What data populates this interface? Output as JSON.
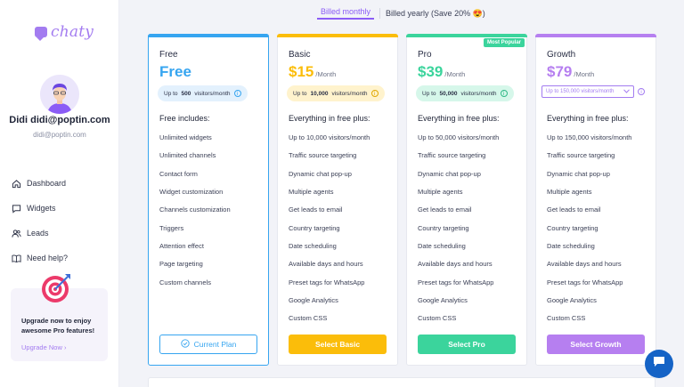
{
  "brand": {
    "name": "chaty",
    "color": "#a37cf0"
  },
  "user": {
    "name": "Didi didi@poptin.com",
    "email": "didi@poptin.com"
  },
  "nav": [
    {
      "label": "Dashboard",
      "icon": "home-icon"
    },
    {
      "label": "Widgets",
      "icon": "chat-icon"
    },
    {
      "label": "Leads",
      "icon": "users-icon"
    },
    {
      "label": "Need help?",
      "icon": "book-icon"
    }
  ],
  "upgrade": {
    "text": "Upgrade now to enjoy awesome Pro features!",
    "link": "Upgrade Now ›"
  },
  "billing": {
    "monthly": "Billed monthly",
    "yearly": "Billed yearly (Save 20% 😍)"
  },
  "plans": {
    "free": {
      "title": "Free",
      "price": "Free",
      "color": "#36a5f0",
      "visitors_prefix": "Up to",
      "visitors_count": "500",
      "visitors_suffix": "visitors/month",
      "includes": "Free includes:",
      "features": [
        "Unlimited widgets",
        "Unlimited channels",
        "Contact form",
        "Widget customization",
        "Channels customization",
        "Triggers",
        "Attention effect",
        "Page targeting",
        "Custom channels"
      ],
      "button": "Current Plan"
    },
    "basic": {
      "title": "Basic",
      "price": "$15",
      "unit": "/Month",
      "color": "#fbbd0a",
      "visitors_prefix": "Up to",
      "visitors_count": "10,000",
      "visitors_suffix": "visitors/month",
      "includes": "Everything in free plus:",
      "features": [
        "Up to 10,000 visitors/month",
        "Traffic source targeting",
        "Dynamic chat pop-up",
        "Multiple agents",
        "Get leads to email",
        "Country targeting",
        "Date scheduling",
        "Available days and hours",
        "Preset tags for WhatsApp",
        "Google Analytics",
        "Custom CSS"
      ],
      "button": "Select Basic"
    },
    "pro": {
      "title": "Pro",
      "price": "$39",
      "unit": "/Month",
      "color": "#3bd49c",
      "badge": "Most Popular",
      "visitors_prefix": "Up to",
      "visitors_count": "50,000",
      "visitors_suffix": "visitors/month",
      "includes": "Everything in free plus:",
      "features": [
        "Up to 50,000 visitors/month",
        "Traffic source targeting",
        "Dynamic chat pop-up",
        "Multiple agents",
        "Get leads to email",
        "Country targeting",
        "Date scheduling",
        "Available days and hours",
        "Preset tags for WhatsApp",
        "Google Analytics",
        "Custom CSS"
      ],
      "button": "Select Pro"
    },
    "growth": {
      "title": "Growth",
      "price": "$79",
      "unit": "/Month",
      "color": "#b67ff0",
      "visitors_select": "Up to 150,000 visitors/month",
      "includes": "Everything in free plus:",
      "features": [
        "Up to 150,000 visitors/month",
        "Traffic source targeting",
        "Dynamic chat pop-up",
        "Multiple agents",
        "Get leads to email",
        "Country targeting",
        "Date scheduling",
        "Available days and hours",
        "Preset tags for WhatsApp",
        "Google Analytics",
        "Custom CSS"
      ],
      "button": "Select Growth"
    }
  }
}
